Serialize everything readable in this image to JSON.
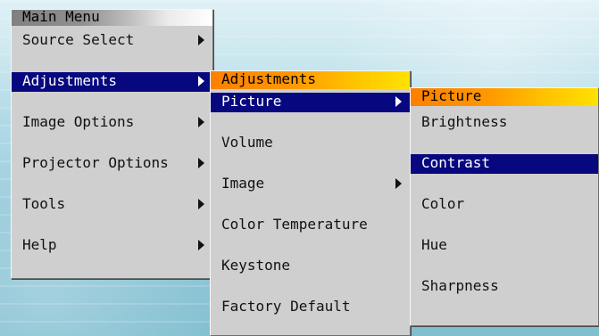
{
  "main_menu": {
    "title": "Main Menu",
    "items": [
      {
        "label": "Source Select",
        "has_submenu": true,
        "selected": false
      },
      {
        "label": "Adjustments",
        "has_submenu": true,
        "selected": true
      },
      {
        "label": "Image Options",
        "has_submenu": true,
        "selected": false
      },
      {
        "label": "Projector Options",
        "has_submenu": true,
        "selected": false
      },
      {
        "label": "Tools",
        "has_submenu": true,
        "selected": false
      },
      {
        "label": "Help",
        "has_submenu": true,
        "selected": false
      }
    ]
  },
  "adjustments_menu": {
    "title": "Adjustments",
    "items": [
      {
        "label": "Picture",
        "has_submenu": true,
        "selected": true
      },
      {
        "label": "Volume",
        "has_submenu": false,
        "selected": false
      },
      {
        "label": "Image",
        "has_submenu": true,
        "selected": false
      },
      {
        "label": "Color Temperature",
        "has_submenu": false,
        "selected": false
      },
      {
        "label": "Keystone",
        "has_submenu": false,
        "selected": false
      },
      {
        "label": "Factory Default",
        "has_submenu": false,
        "selected": false
      }
    ]
  },
  "picture_menu": {
    "title": "Picture",
    "items": [
      {
        "label": "Brightness",
        "selected": false
      },
      {
        "label": "Contrast",
        "selected": true
      },
      {
        "label": "Color",
        "selected": false
      },
      {
        "label": "Hue",
        "selected": false
      },
      {
        "label": "Sharpness",
        "selected": false
      }
    ]
  },
  "colors": {
    "selection": "#07087f",
    "menu_face": "#cfcfcf",
    "main_title_dark": "#808080",
    "submenu_title_orange": "#ff7f00",
    "submenu_title_yellow": "#ffe100"
  },
  "icons": {
    "submenu": "chevron-right-icon"
  }
}
